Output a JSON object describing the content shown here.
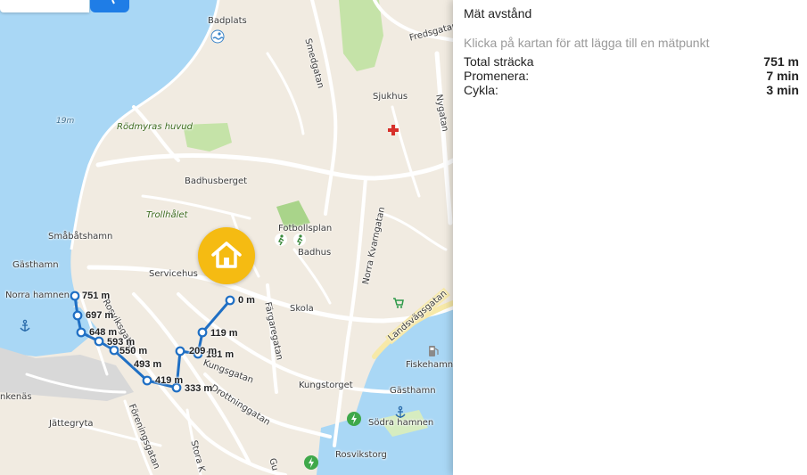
{
  "panel": {
    "title": "Mät avstånd",
    "hint": "Klicka på kartan för att lägga till en mätpunkt",
    "stats": [
      {
        "label": "Total sträcka",
        "value": "751 m"
      },
      {
        "label": "Promenera:",
        "value": "7 min"
      },
      {
        "label": "Cykla:",
        "value": "3 min"
      }
    ]
  },
  "map": {
    "place_labels": [
      "Badplats",
      "Smedgatan",
      "Fredsgatan",
      "Sjukhus",
      "Nygatan",
      "19m",
      "Rödmyras huvud",
      "Badhusberget",
      "Trollhålet",
      "Småbåtshamn",
      "Gästhamn",
      "Fotbollsplan",
      "Badhus",
      "Norra Kvarngatan",
      "Servicehus",
      "Norra hamnen",
      "Skola",
      "Färgaregatan",
      "Landsvägsgatan",
      "Rosviksgatan",
      "Kungsgatan",
      "Fiskehamn",
      "Gästhamn",
      "Kungstorget",
      "Drottninggatan",
      "Södra hamnen",
      "nkenäs",
      "Jättegryta",
      "Föreningsgatan",
      "Stora K",
      "Gu",
      "Rosvikstorg"
    ],
    "measure_labels": [
      "0 m",
      "119 m",
      "181 m",
      "209 m",
      "333 m",
      "419 m",
      "493 m",
      "550 m",
      "593 m",
      "648 m",
      "697 m",
      "751 m"
    ],
    "route_color": "#1f6fc4",
    "home_pin_color": "#f5bb12",
    "water_color": "#a9d7f5",
    "icons": [
      "search-icon",
      "home-icon",
      "swimming-icon",
      "hospital-cross-icon",
      "sports-icon",
      "shopping-cart-icon",
      "fuel-icon",
      "anchor-icon",
      "ev-charging-icon"
    ]
  }
}
